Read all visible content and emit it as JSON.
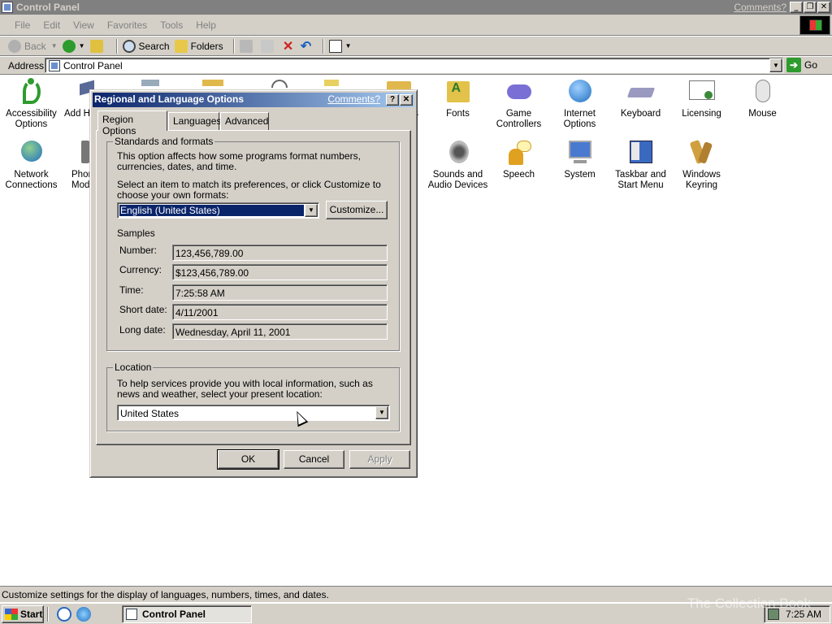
{
  "window": {
    "title": "Control Panel",
    "comments_link": "Comments?"
  },
  "menu": [
    "File",
    "Edit",
    "View",
    "Favorites",
    "Tools",
    "Help"
  ],
  "toolbar": {
    "back": "Back",
    "search": "Search",
    "folders": "Folders"
  },
  "address": {
    "label": "Address",
    "value": "Control Panel",
    "go": "Go"
  },
  "icons": [
    {
      "name": "Accessibility Options",
      "icon": "accessibility-icon",
      "color": "#2f9b2f"
    },
    {
      "name": "Add H",
      "icon": "add-hardware-icon",
      "color": "#6b7bb0"
    },
    {
      "name": "ns",
      "icon": "admin-tools-icon",
      "color": "#e0b84c"
    },
    {
      "name": "Fonts",
      "icon": "fonts-icon",
      "color": "#e2c24a"
    },
    {
      "name": "Game Controllers",
      "icon": "game-controllers-icon",
      "color": "#7a6fd4"
    },
    {
      "name": "Internet Options",
      "icon": "internet-options-icon",
      "color": "#2f7fd0"
    },
    {
      "name": "Keyboard",
      "icon": "keyboard-icon",
      "color": "#8a8ab0"
    },
    {
      "name": "Licensing",
      "icon": "licensing-icon",
      "color": "#c0a060"
    },
    {
      "name": "Mouse",
      "icon": "mouse-icon",
      "color": "#bbbbbb"
    },
    {
      "name": "Network Connections",
      "icon": "network-connections-icon",
      "color": "#3a8fd0"
    },
    {
      "name": "Phon Mod",
      "icon": "phone-modem-icon",
      "color": "#777777"
    },
    {
      "name": "Sounds and Audio Devices",
      "icon": "sounds-icon",
      "color": "#909090"
    },
    {
      "name": "Speech",
      "icon": "speech-icon",
      "color": "#e0a020"
    },
    {
      "name": "System",
      "icon": "system-icon",
      "color": "#4a7ad0"
    },
    {
      "name": "Taskbar and Start Menu",
      "icon": "taskbar-icon",
      "color": "#3a6ac0"
    },
    {
      "name": "Windows Keyring",
      "icon": "keyring-icon",
      "color": "#d0a040"
    }
  ],
  "status": "Customize settings for the display of languages, numbers, times, and dates.",
  "taskbar": {
    "start": "Start",
    "task": "Control Panel",
    "clock": "7:25 AM",
    "watermark": "The Collection Book"
  },
  "dialog": {
    "title": "Regional and Language Options",
    "comments": "Comments?",
    "tabs": [
      "Region Options",
      "Languages",
      "Advanced"
    ],
    "standards": {
      "group_label": "Standards and formats",
      "description": "This option affects how some programs format numbers, currencies, dates, and time.",
      "select_prompt": "Select an item to match its preferences, or click Customize to choose your own formats:",
      "selected_format": "English (United States)",
      "customize_button": "Customize..."
    },
    "samples": {
      "heading": "Samples",
      "rows": [
        {
          "label": "Number:",
          "value": "123,456,789.00"
        },
        {
          "label": "Currency:",
          "value": "$123,456,789.00"
        },
        {
          "label": "Time:",
          "value": "7:25:58 AM"
        },
        {
          "label": "Short date:",
          "value": "4/11/2001"
        },
        {
          "label": "Long date:",
          "value": "Wednesday, April 11, 2001"
        }
      ]
    },
    "location": {
      "group_label": "Location",
      "description": "To help services provide you with local information, such as news and weather, select your present location:",
      "selected": "United States"
    },
    "buttons": {
      "ok": "OK",
      "cancel": "Cancel",
      "apply": "Apply"
    }
  }
}
